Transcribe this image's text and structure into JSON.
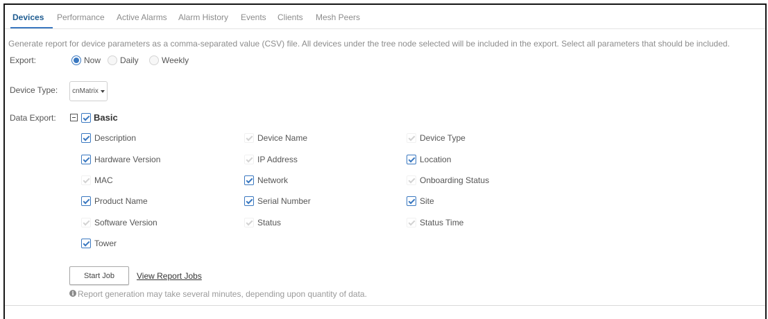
{
  "tabs": [
    {
      "label": "Devices",
      "active": true
    },
    {
      "label": "Performance",
      "active": false
    },
    {
      "label": "Active Alarms",
      "active": false
    },
    {
      "label": "Alarm History",
      "active": false
    },
    {
      "label": "Events",
      "active": false
    },
    {
      "label": "Clients",
      "active": false
    },
    {
      "label": "Mesh Peers",
      "active": false
    }
  ],
  "description": "Generate report for device parameters as a comma-separated value (CSV) file. All devices under the tree node selected will be included in the export. Select all parameters that should be included.",
  "export": {
    "label": "Export:",
    "options": [
      {
        "label": "Now",
        "selected": true
      },
      {
        "label": "Daily",
        "selected": false
      },
      {
        "label": "Weekly",
        "selected": false
      }
    ]
  },
  "device_type": {
    "label": "Device Type:",
    "value": "cnMatrix",
    "icon": "caret-down-icon"
  },
  "data_export": {
    "label": "Data Export:",
    "group": {
      "label": "Basic",
      "checked": true,
      "expanded": true,
      "icon": "collapse-icon"
    },
    "fields": [
      {
        "label": "Description",
        "checked": true,
        "disabled": false
      },
      {
        "label": "Device Name",
        "checked": true,
        "disabled": true
      },
      {
        "label": "Device Type",
        "checked": true,
        "disabled": true
      },
      {
        "label": "Hardware Version",
        "checked": true,
        "disabled": false
      },
      {
        "label": "IP Address",
        "checked": true,
        "disabled": true
      },
      {
        "label": "Location",
        "checked": true,
        "disabled": false
      },
      {
        "label": "MAC",
        "checked": true,
        "disabled": true
      },
      {
        "label": "Network",
        "checked": true,
        "disabled": false
      },
      {
        "label": "Onboarding Status",
        "checked": true,
        "disabled": true
      },
      {
        "label": "Product Name",
        "checked": true,
        "disabled": false
      },
      {
        "label": "Serial Number",
        "checked": true,
        "disabled": false
      },
      {
        "label": "Site",
        "checked": true,
        "disabled": false
      },
      {
        "label": "Software Version",
        "checked": true,
        "disabled": true
      },
      {
        "label": "Status",
        "checked": true,
        "disabled": true
      },
      {
        "label": "Status Time",
        "checked": true,
        "disabled": true
      },
      {
        "label": "Tower",
        "checked": true,
        "disabled": false
      }
    ]
  },
  "actions": {
    "start_job": "Start Job",
    "view_report_jobs": "View Report Jobs"
  },
  "note": {
    "icon": "info-icon",
    "text": "Report generation may take several minutes, depending upon quantity of data."
  },
  "colors": {
    "accent": "#3a78c0",
    "active_tab": "#1f5c91",
    "text": "#555555",
    "muted": "#8c8c8c",
    "disabled_check": "#d2d2d2"
  }
}
